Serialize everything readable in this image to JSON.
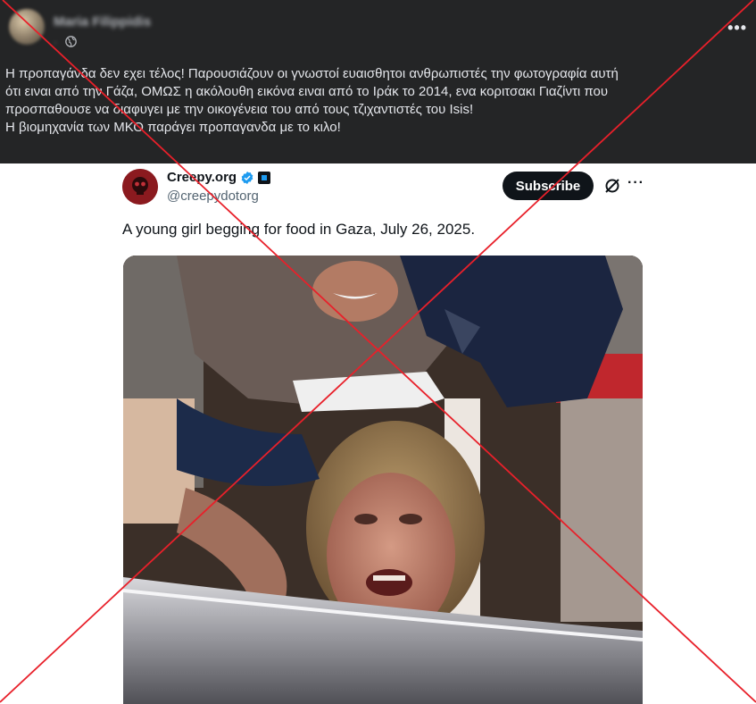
{
  "facebook_post": {
    "author": "Maria Filippidis",
    "meta_dot": "·",
    "visibility_icon": "globe-icon",
    "more_icon": "more-horizontal-icon",
    "more_label": "•••",
    "text_lines": [
      "Η προπαγάνδα δεν εχει τέλος! Παρουσιάζουν οι γνωστοί ευαισθητοι ανθρωπιστές την φωτογραφία αυτή",
      "ότι ειναι από την Γάζα, ΟΜΩΣ η ακόλουθη εικόνα ειναι από το Ιράκ το 2014, ενα κοριτσακι Γιαζίντι που",
      "προσπαθουσε να διαφυγει με την οικογένεια του από τους τζιχαντιστές του Isis!",
      "Η βιομηχανία των ΜΚΟ παράγει προπαγανδα με το κιλο!"
    ]
  },
  "tweet": {
    "display_name": "Creepy.org",
    "handle": "@creepydotorg",
    "verified_icon": "verified-badge-icon",
    "affiliate_icon": "affiliate-badge-icon",
    "subscribe_label": "Subscribe",
    "grok_icon": "grok-icon",
    "more_label": "···",
    "text": "A young girl begging for food in Gaza, July 26, 2025.",
    "photo_icon": "photo"
  },
  "overlay": {
    "type": "red-x-cross",
    "color": "#e8202a"
  }
}
